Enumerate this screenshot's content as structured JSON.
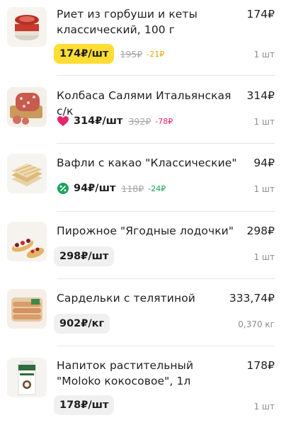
{
  "colors": {
    "yellow_chip": "#ffdd33",
    "gray_chip": "#f0f0f0",
    "heart": "#e3266a",
    "discount_green": "#1aa35a",
    "discount_yellow": "#e0a800"
  },
  "items": [
    {
      "name": "Риет из горбуши и кеты классический, 100 г",
      "total": "174₽",
      "price": "174₽/шт",
      "old_price": "195₽",
      "discount": "-21₽",
      "qty": "1 шт",
      "icon": "salmon-rillettes-jar-icon"
    },
    {
      "name": "Колбаса Салями Итальянская с/к",
      "total": "314₽",
      "price": "314₽/шт",
      "old_price": "392₽",
      "discount": "-78₽",
      "qty": "1 шт",
      "icon": "salami-icon"
    },
    {
      "name": "Вафли с какао \"Классические\"",
      "total": "94₽",
      "price": "94₽/шт",
      "old_price": "118₽",
      "discount": "-24₽",
      "qty": "1 шт",
      "icon": "wafers-icon"
    },
    {
      "name": "Пирожное \"Ягодные лодочки\"",
      "total": "298₽",
      "price": "298₽/шт",
      "qty": "1 шт",
      "icon": "berry-tart-icon"
    },
    {
      "name": "Сардельки с телятиной",
      "total": "333,74₽",
      "price": "902₽/кг",
      "qty": "0,370 кг",
      "icon": "sausages-icon"
    },
    {
      "name": "Напиток растительный \"Moloko кокосовое\", 1л",
      "total": "178₽",
      "price": "178₽/шт",
      "qty": "1 шт",
      "icon": "coconut-milk-carton-icon"
    }
  ]
}
